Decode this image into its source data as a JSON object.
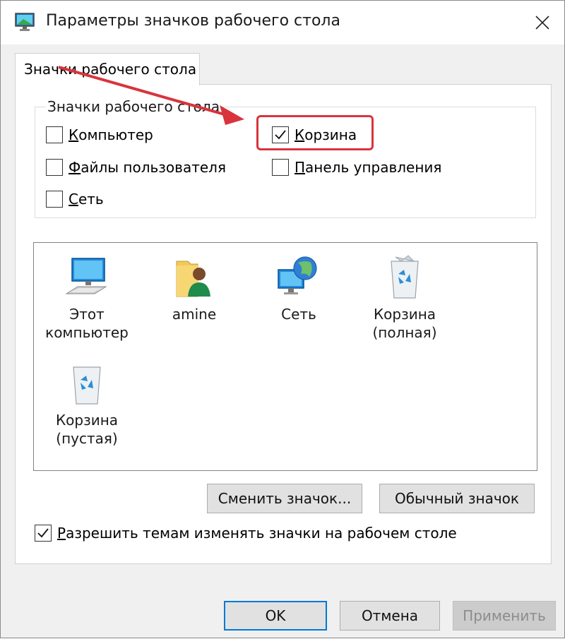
{
  "window": {
    "title": "Параметры значков рабочего стола",
    "app_icon": "desktop-monitor-icon",
    "close_icon": "close-icon"
  },
  "tab": {
    "label": "Значки рабочего стола"
  },
  "group": {
    "label": "Значки рабочего стола",
    "checkboxes": [
      {
        "id": "computer",
        "label": "Компьютер",
        "underline": "К",
        "rest": "омпьютер",
        "checked": false
      },
      {
        "id": "user-files",
        "label": "Файлы пользователя",
        "underline": "Ф",
        "rest": "айлы пользователя",
        "checked": false
      },
      {
        "id": "network",
        "label": "Сеть",
        "underline": "С",
        "rest": "еть",
        "checked": false
      },
      {
        "id": "recycle-bin",
        "label": "Корзина",
        "underline": "К",
        "rest": "орзина",
        "checked": true
      },
      {
        "id": "control-panel",
        "label": "Панель управления",
        "underline": "П",
        "rest": "анель управления",
        "checked": false
      }
    ]
  },
  "icons": [
    {
      "line1": "Этот",
      "line2": "компьютер",
      "icon": "computer-icon"
    },
    {
      "line1": "amine",
      "line2": "",
      "icon": "user-folder-icon"
    },
    {
      "line1": "Сеть",
      "line2": "",
      "icon": "network-icon"
    },
    {
      "line1": "Корзина",
      "line2": "(полная)",
      "icon": "recycle-bin-full-icon"
    },
    {
      "line1": "Корзина",
      "line2": "(пустая)",
      "icon": "recycle-bin-empty-icon"
    }
  ],
  "buttons": {
    "change_icon": "Сменить значок...",
    "change_icon_u": "з",
    "default_icon": "Обычный значок",
    "ok": "OK",
    "cancel": "Отмена",
    "apply": "Применить"
  },
  "themes_checkbox": {
    "label": "Разрешить темам изменять значки на рабочем столе",
    "underline": "Р",
    "rest": "азрешить темам изменять значки на рабочем столе",
    "checked": true
  },
  "colors": {
    "highlight": "#d9343c",
    "accent": "#0078d7"
  }
}
